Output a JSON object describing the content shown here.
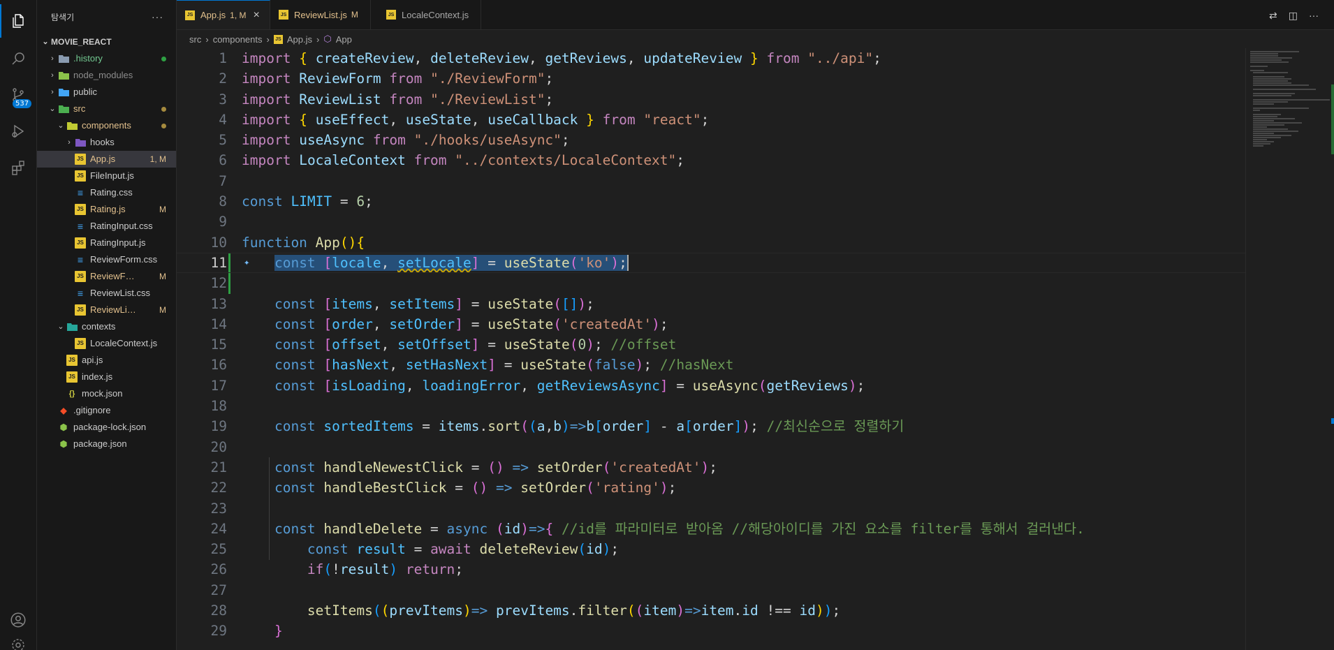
{
  "activity_bar": {
    "items": [
      {
        "icon": "files-icon"
      },
      {
        "icon": "search-icon"
      },
      {
        "icon": "source-control-icon",
        "badge": "537"
      },
      {
        "icon": "run-debug-icon"
      },
      {
        "icon": "extensions-icon"
      }
    ],
    "bottom": [
      {
        "icon": "account-icon"
      },
      {
        "icon": "settings-gear-icon"
      }
    ]
  },
  "sidebar": {
    "title": "탐색기",
    "more": "···",
    "root": "MOVIE_REACT",
    "items": [
      {
        "label": ".history",
        "depth": 1,
        "type": "folder",
        "chev": "›",
        "color": "#73c991",
        "dot": "#2ea043"
      },
      {
        "label": "node_modules",
        "depth": 1,
        "type": "folder-node",
        "chev": "›",
        "color": "#8c8c8c"
      },
      {
        "label": "public",
        "depth": 1,
        "type": "folder-public",
        "chev": "›",
        "color": "#cccccc"
      },
      {
        "label": "src",
        "depth": 1,
        "type": "folder-src",
        "chev": "⌄",
        "color": "#e2c08d",
        "dot": "#a58a3e"
      },
      {
        "label": "components",
        "depth": 2,
        "type": "folder-comp",
        "chev": "⌄",
        "color": "#e2c08d",
        "dot": "#a58a3e"
      },
      {
        "label": "hooks",
        "depth": 3,
        "type": "folder-hooks",
        "chev": "›",
        "color": "#cccccc"
      },
      {
        "label": "App.js",
        "depth": 3,
        "type": "js",
        "color": "#e2c08d",
        "status": "1, M",
        "selected": true
      },
      {
        "label": "FileInput.js",
        "depth": 3,
        "type": "js",
        "color": "#cccccc"
      },
      {
        "label": "Rating.css",
        "depth": 3,
        "type": "css",
        "color": "#cccccc"
      },
      {
        "label": "Rating.js",
        "depth": 3,
        "type": "js",
        "color": "#e2c08d",
        "status": "M"
      },
      {
        "label": "RatingInput.css",
        "depth": 3,
        "type": "css",
        "color": "#cccccc"
      },
      {
        "label": "RatingInput.js",
        "depth": 3,
        "type": "js",
        "color": "#cccccc"
      },
      {
        "label": "ReviewForm.css",
        "depth": 3,
        "type": "css",
        "color": "#cccccc"
      },
      {
        "label": "ReviewForm...",
        "depth": 3,
        "type": "js",
        "color": "#e2c08d",
        "status": "M"
      },
      {
        "label": "ReviewList.css",
        "depth": 3,
        "type": "css",
        "color": "#cccccc"
      },
      {
        "label": "ReviewList.js",
        "depth": 3,
        "type": "js",
        "color": "#e2c08d",
        "status": "M"
      },
      {
        "label": "contexts",
        "depth": 2,
        "type": "folder-ctx",
        "chev": "⌄",
        "color": "#cccccc"
      },
      {
        "label": "LocaleContext.js",
        "depth": 3,
        "type": "js",
        "color": "#cccccc"
      },
      {
        "label": "api.js",
        "depth": 2,
        "type": "js",
        "color": "#cccccc"
      },
      {
        "label": "index.js",
        "depth": 2,
        "type": "js",
        "color": "#cccccc"
      },
      {
        "label": "mock.json",
        "depth": 2,
        "type": "json",
        "color": "#cccccc"
      },
      {
        "label": ".gitignore",
        "depth": 1,
        "type": "git",
        "color": "#cccccc"
      },
      {
        "label": "package-lock.json",
        "depth": 1,
        "type": "pkg",
        "color": "#cccccc"
      },
      {
        "label": "package.json",
        "depth": 1,
        "type": "pkg",
        "color": "#cccccc"
      }
    ]
  },
  "tabs": [
    {
      "label": "App.js",
      "status": "1, M",
      "active": true,
      "close": "×",
      "color": "#e2c08d"
    },
    {
      "label": "ReviewList.js",
      "status": "M",
      "active": false,
      "color": "#e2c08d"
    },
    {
      "label": "LocaleContext.js",
      "active": false,
      "color": "#cccccc"
    }
  ],
  "breadcrumb": {
    "parts": [
      "src",
      "components",
      "App.js",
      "App"
    ],
    "sep": "›"
  },
  "editor": {
    "current_line": 11,
    "line_numbers": [
      "1",
      "2",
      "3",
      "4",
      "5",
      "6",
      "7",
      "8",
      "9",
      "10",
      "11",
      "12",
      "13",
      "14",
      "15",
      "16",
      "17",
      "18",
      "19",
      "20",
      "21",
      "22",
      "23",
      "24",
      "25",
      "26",
      "27",
      "28",
      "29"
    ]
  },
  "colors": {
    "accent": "#0078d4",
    "modified": "#e2c08d",
    "selection": "#264f78"
  }
}
